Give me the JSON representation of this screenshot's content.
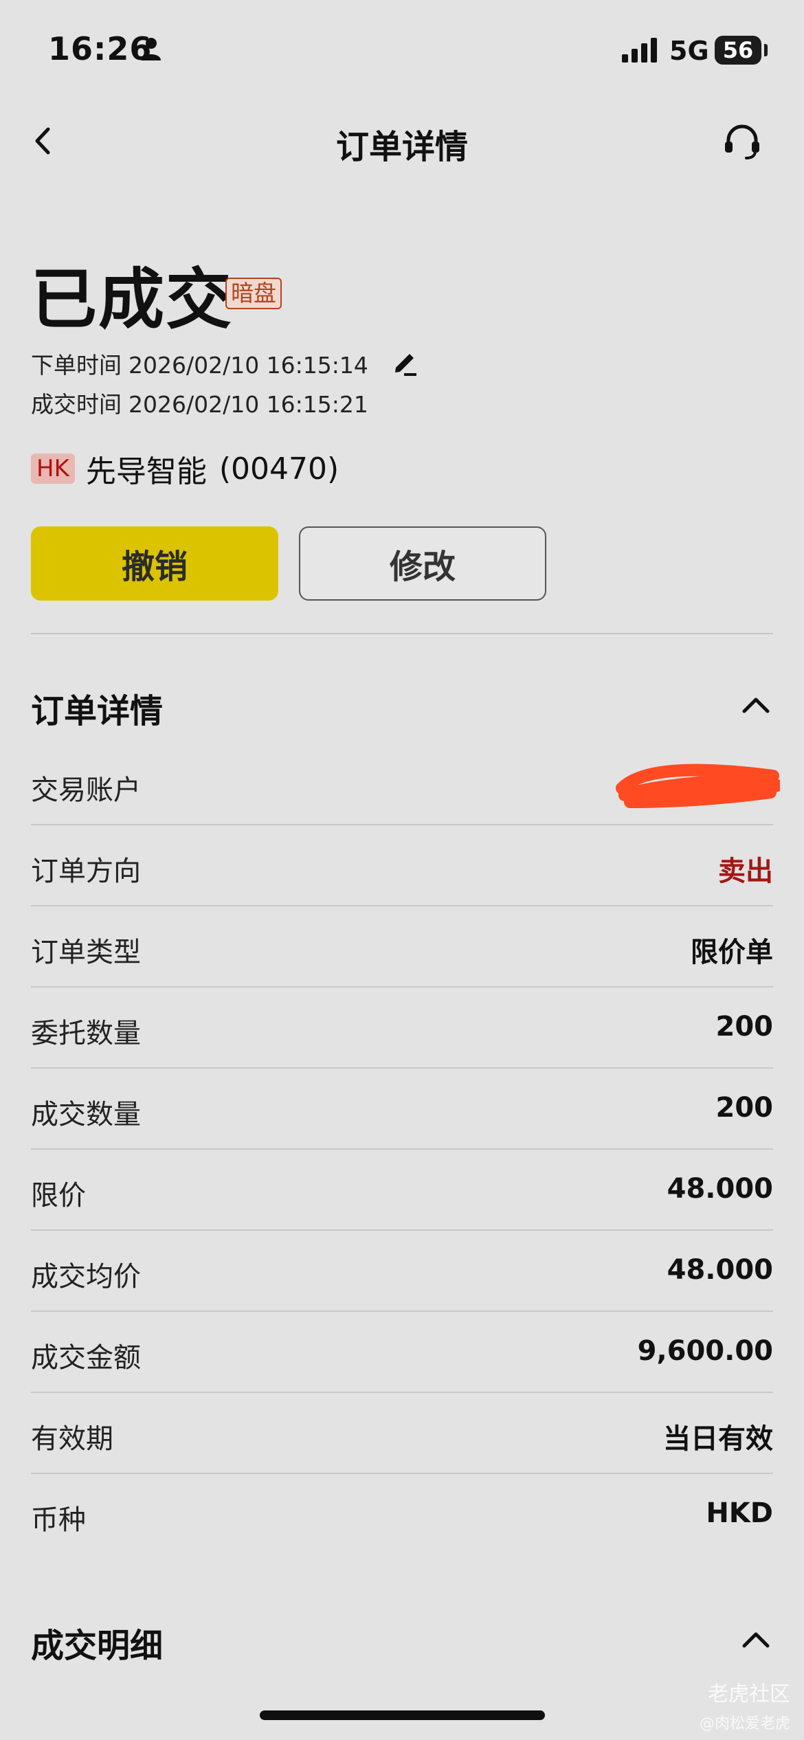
{
  "status_bar": {
    "time": "16:26",
    "network": "5G",
    "battery": "56"
  },
  "nav": {
    "title": "订单详情"
  },
  "order": {
    "status": "已成交",
    "status_badge": "暗盘",
    "placed_label": "下单时间",
    "placed_time": "2026/02/10 16:15:14",
    "filled_label": "成交时间",
    "filled_time": "2026/02/10 16:15:21",
    "market": "HK",
    "stock_name": "先导智能",
    "stock_code": "(00470)"
  },
  "actions": {
    "cancel_label": "撤销",
    "modify_label": "修改"
  },
  "detail_section": {
    "title": "订单详情",
    "rows": [
      {
        "label": "交易账户",
        "value": ""
      },
      {
        "label": "订单方向",
        "value": "卖出"
      },
      {
        "label": "订单类型",
        "value": "限价单"
      },
      {
        "label": "委托数量",
        "value": "200"
      },
      {
        "label": "成交数量",
        "value": "200"
      },
      {
        "label": "限价",
        "value": "48.000"
      },
      {
        "label": "成交均价",
        "value": "48.000"
      },
      {
        "label": "成交金额",
        "value": "9,600.00"
      },
      {
        "label": "有效期",
        "value": "当日有效"
      },
      {
        "label": "币种",
        "value": "HKD"
      }
    ]
  },
  "fills_section": {
    "title": "成交明细"
  },
  "watermark": {
    "text": "老虎社区",
    "sub": "@肉松爱老虎"
  },
  "colors": {
    "accent_yellow": "#dbc300",
    "sell_red": "#a51515",
    "redaction": "#ff4a22"
  }
}
